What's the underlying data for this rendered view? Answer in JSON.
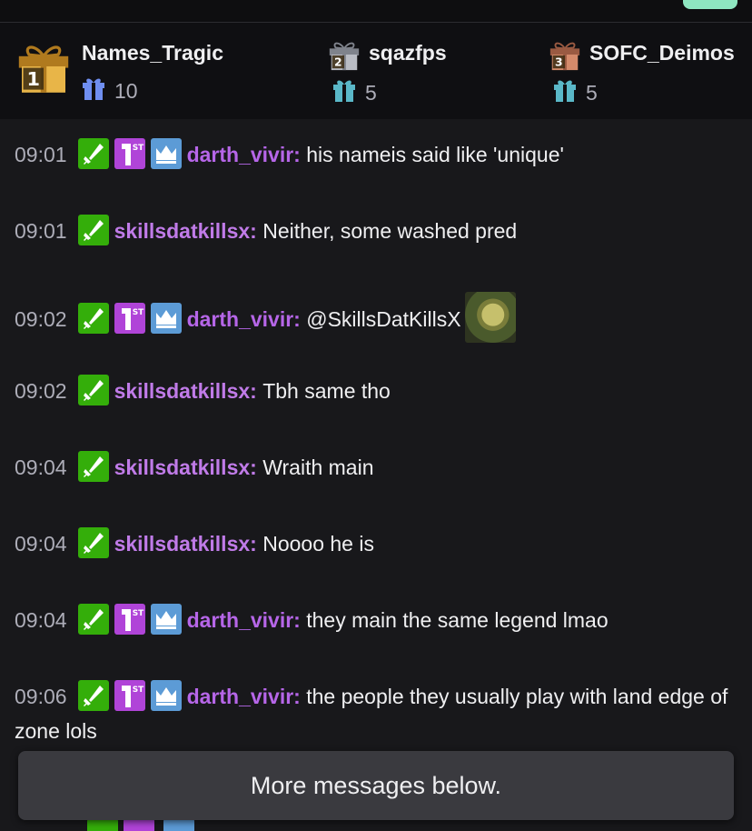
{
  "colors": {
    "background": "#18181b",
    "leaderboard_bg": "#0f0f12",
    "username_purple": "#b666e8",
    "username_violet": "#c07be8",
    "timestamp": "#adadb8",
    "moderator_badge": "#34ae0a",
    "first_badge": "#b044d8",
    "vip_badge": "#5c9bd6",
    "banner_bg": "#3a3a3f",
    "accent": "#8ee6c0"
  },
  "leaderboard": {
    "gifters": [
      {
        "rank": "1",
        "name": "Names_Tragic",
        "count": "10",
        "icon": "gold-gift-rank-icon"
      },
      {
        "rank": "2",
        "name": "sqazfps",
        "count": "5",
        "icon": "silver-gift-rank-icon"
      },
      {
        "rank": "3",
        "name": "SOFC_Deimos",
        "count": "5",
        "icon": "bronze-gift-rank-icon"
      }
    ]
  },
  "messages": [
    {
      "time": "09:01",
      "badges": [
        "moderator",
        "first",
        "vip"
      ],
      "user": "darth_vivir",
      "text": "his nameis said like 'unique'"
    },
    {
      "time": "09:01",
      "badges": [
        "moderator"
      ],
      "user": "skillsdatkillsx",
      "text": "Neither, some washed pred"
    },
    {
      "time": "09:02",
      "badges": [
        "moderator",
        "first",
        "vip"
      ],
      "user": "darth_vivir",
      "text": "@SkillsDatKillsX",
      "emote": "shrek-emote"
    },
    {
      "time": "09:02",
      "badges": [
        "moderator"
      ],
      "user": "skillsdatkillsx",
      "text": "Tbh same tho"
    },
    {
      "time": "09:04",
      "badges": [
        "moderator"
      ],
      "user": "skillsdatkillsx",
      "text": "Wraith main"
    },
    {
      "time": "09:04",
      "badges": [
        "moderator"
      ],
      "user": "skillsdatkillsx",
      "text": "Noooo he is"
    },
    {
      "time": "09:04",
      "badges": [
        "moderator",
        "first",
        "vip"
      ],
      "user": "darth_vivir",
      "text": "they main the same legend lmao"
    },
    {
      "time": "09:06",
      "badges": [
        "moderator",
        "first",
        "vip"
      ],
      "user": "darth_vivir",
      "text": "the people they usually play with land edge of zone lols"
    }
  ],
  "banner": {
    "label": "More messages below."
  }
}
